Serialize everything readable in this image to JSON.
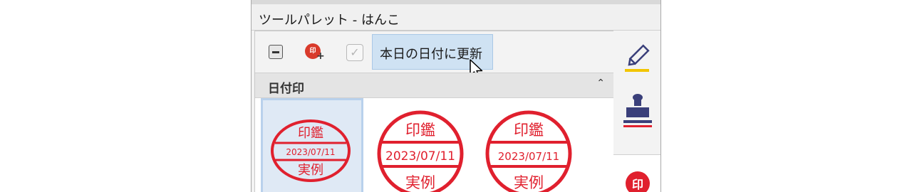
{
  "window": {
    "title": "ツールパレット - はんこ"
  },
  "toolbar": {
    "collapse_icon": "collapse-box-icon",
    "add_stamp_icon": "add-stamp-icon",
    "add_stamp_glyph": "印",
    "checkbox_icon": "checkbox-icon",
    "update_label": "本日の日付に更新"
  },
  "section": {
    "title": "日付印",
    "chevron": "⌃"
  },
  "stamps": [
    {
      "top": "印鑑",
      "date": "2023/07/11",
      "bottom": "実例",
      "shape": "oval",
      "selected": true
    },
    {
      "top": "印鑑",
      "date": "2023/07/11",
      "bottom": "実例",
      "shape": "circle",
      "selected": false
    },
    {
      "top": "印鑑",
      "date": "2023/07/11",
      "bottom": "実例",
      "shape": "circle",
      "selected": false
    }
  ],
  "side_tabs": [
    {
      "icon": "pen-icon"
    },
    {
      "icon": "stamp-icon"
    },
    {
      "icon": "seal-icon",
      "glyph": "印"
    }
  ],
  "colors": {
    "stamp_red": "#e0202e",
    "highlight": "#cfe2f3"
  }
}
